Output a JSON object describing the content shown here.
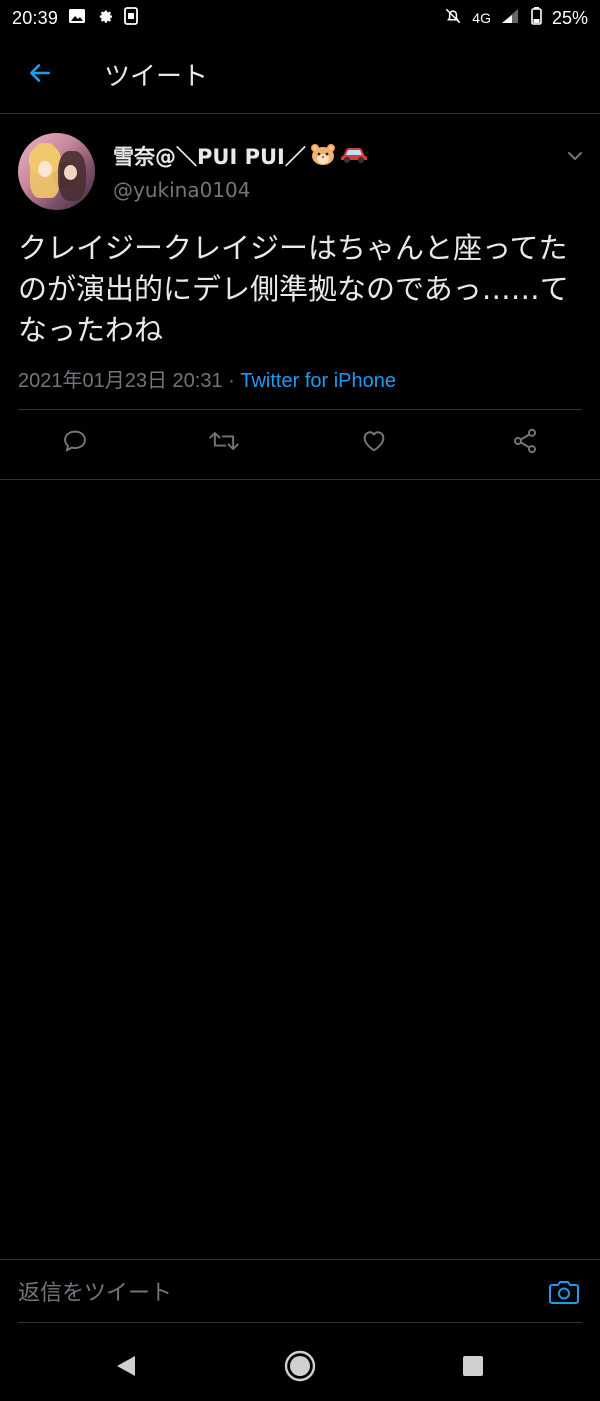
{
  "status_bar": {
    "time": "20:39",
    "network": "4G",
    "battery": "25%"
  },
  "header": {
    "title": "ツイート"
  },
  "tweet": {
    "display_name": "雪奈@＼PUI PUI／",
    "handle": "@yukina0104",
    "text": "クレイジークレイジーはちゃんと座ってたのが演出的にデレ側準拠なのであっ……てなったわね",
    "timestamp": "2021年01月23日 20:31",
    "separator": " · ",
    "source": "Twitter for iPhone"
  },
  "reply": {
    "placeholder": "返信をツイート"
  },
  "colors": {
    "accent": "#1d9bf0",
    "background": "#000000",
    "text": "#e7e9ea",
    "muted": "#71767b",
    "divider": "#2f3336"
  },
  "icons": {
    "back": "arrow-left-icon",
    "caret": "chevron-down-icon",
    "reply": "comment-icon",
    "retweet": "retweet-icon",
    "like": "heart-icon",
    "share": "share-icon",
    "camera": "camera-icon"
  }
}
